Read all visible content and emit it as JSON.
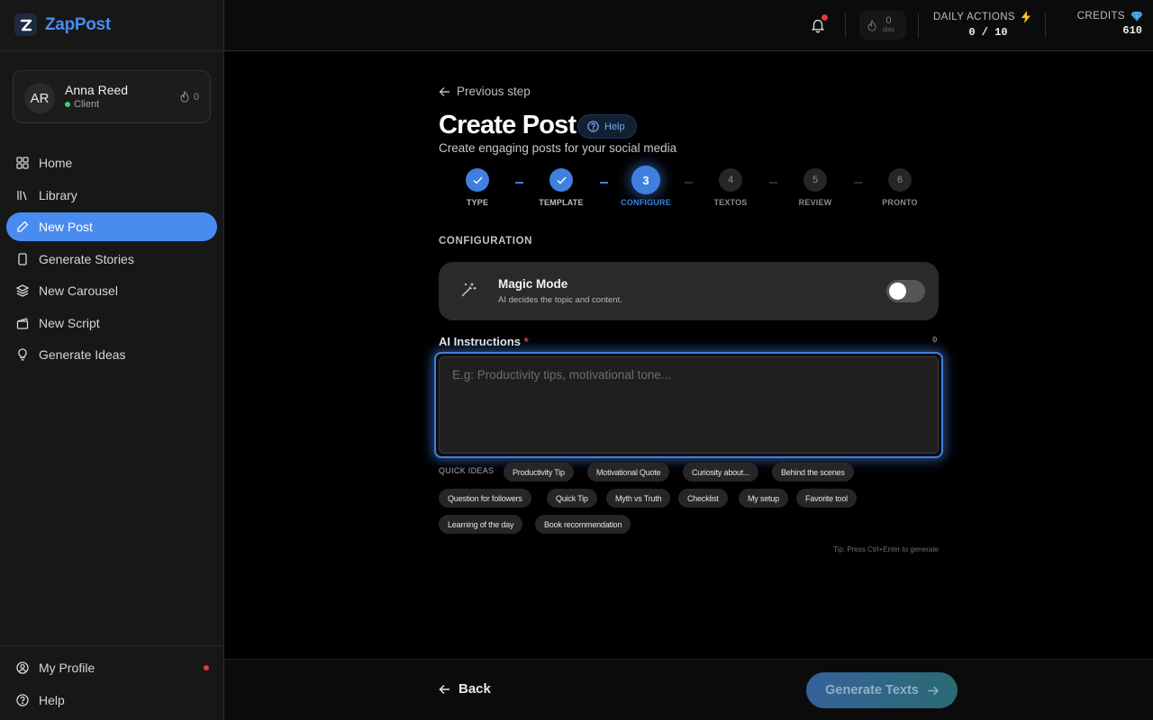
{
  "app": {
    "name": "ZapPost",
    "logo_text": "ZapPost"
  },
  "user": {
    "initials": "AR",
    "name": "Anna Reed",
    "role": "Client",
    "streak": "0"
  },
  "sidebar": {
    "items": [
      {
        "label": "Home",
        "icon": "grid-icon"
      },
      {
        "label": "Library",
        "icon": "library-icon"
      },
      {
        "label": "New Post",
        "icon": "pencil-icon",
        "active": true
      },
      {
        "label": "Generate Stories",
        "icon": "phone-icon"
      },
      {
        "label": "New Carousel",
        "icon": "layers-icon"
      },
      {
        "label": "New Script",
        "icon": "clapperboard-icon"
      },
      {
        "label": "Generate Ideas",
        "icon": "lightbulb-icon"
      }
    ],
    "bottom": [
      {
        "label": "My Profile",
        "icon": "user-circle-icon"
      },
      {
        "label": "Help",
        "icon": "help-circle-icon"
      }
    ]
  },
  "topbar": {
    "streak_days": "0",
    "streak_label": "dias",
    "daily_actions_label": "DAILY ACTIONS",
    "daily_actions_value": "0 / 10",
    "credits_label": "CREDITS",
    "credits_value": "610"
  },
  "page": {
    "previous_step": "Previous step",
    "title": "Create Post",
    "help_label": "Help",
    "subtitle": "Create engaging posts for your social media"
  },
  "steps": [
    {
      "number": "1",
      "label": "TYPE",
      "status": "done"
    },
    {
      "number": "2",
      "label": "TEMPLATE",
      "status": "done"
    },
    {
      "number": "3",
      "label": "CONFIGURE",
      "status": "current"
    },
    {
      "number": "4",
      "label": "TEXTOS",
      "status": "pending"
    },
    {
      "number": "5",
      "label": "REVIEW",
      "status": "pending"
    },
    {
      "number": "6",
      "label": "PRONTO",
      "status": "pending"
    }
  ],
  "configuration": {
    "section_title": "CONFIGURATION",
    "magic_mode_title": "Magic Mode",
    "magic_mode_subtitle": "AI decides the topic and content.",
    "magic_mode_on": false,
    "ai_instructions_label": "AI Instructions",
    "required_mark": "*",
    "char_count": "0",
    "ai_instructions_value": "",
    "ai_instructions_placeholder": "E.g: Productivity tips, motivational tone..."
  },
  "quick_ideas": {
    "label": "QUICK IDEAS",
    "chips": [
      "Productivity Tip",
      "Motivational Quote",
      "Curiosity about...",
      "Behind the scenes",
      "Question for followers",
      "Quick Tip",
      "Myth vs Truth",
      "Checklist",
      "My setup",
      "Favorite tool",
      "Learning of the day",
      "Book recommendation"
    ]
  },
  "tip": "Tip: Press Ctrl+Enter to generate",
  "footer": {
    "back_label": "Back",
    "generate_label": "Generate Texts"
  },
  "colors": {
    "accent": "#4a8bf0",
    "notification": "#e0393e",
    "online": "#3bd17a"
  }
}
